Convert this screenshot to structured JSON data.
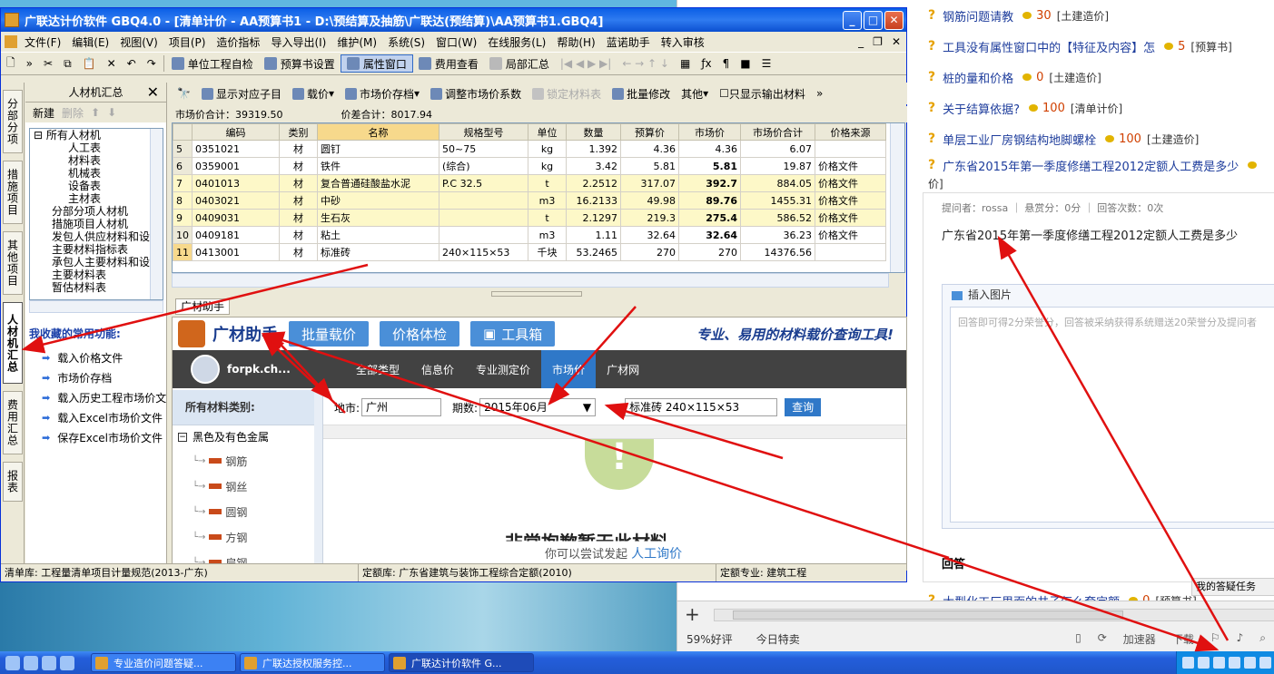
{
  "browser": {
    "questions": [
      {
        "title": "钢筋问题请教",
        "score": "30",
        "cat": "[土建造价]"
      },
      {
        "title": "工具没有属性窗口中的【特征及内容】怎",
        "score": "5",
        "cat": "[预算书]"
      },
      {
        "title": "桩的量和价格",
        "score": "0",
        "cat": "[土建造价]"
      },
      {
        "title": "关于结算依据?",
        "score": "100",
        "cat": "[清单计价]"
      },
      {
        "title": "单层工业厂房钢结构地脚螺栓",
        "score": "100",
        "cat": "[土建造价]"
      },
      {
        "title": "广东省2015年第一季度修缮工程2012定额人工费是多少",
        "score": "",
        "cat": ""
      }
    ],
    "wrap_text": "价]",
    "meta": "提问者：rossa  ｜  悬赏分：0分  ｜  回答次数：0次",
    "question_body": "广东省2015年第一季度修缮工程2012定额人工费是多少",
    "insert_image": "插入图片",
    "answer_placeholder": "回答即可得2分荣誉分，回答被采纳获得系统赠送20荣誉分及提问者",
    "answer_label": "回答",
    "my_task": "我的答疑任务",
    "last_question": {
      "title": "大型化工厂里面的井子怎么套定额",
      "score": "0",
      "cat": "[预算书]"
    },
    "status_items": [
      "59%好评",
      "今日特卖"
    ],
    "status_icons": [
      "加速器",
      "下载"
    ]
  },
  "app": {
    "title": "广联达计价软件 GBQ4.0 - [清单计价 - AA预算书1 - D:\\预结算及抽筋\\广联达(预结算)\\AA预算书1.GBQ4]",
    "menu": [
      "文件(F)",
      "编辑(E)",
      "视图(V)",
      "项目(P)",
      "造价指标",
      "导入导出(I)",
      "维护(M)",
      "系统(S)",
      "窗口(W)",
      "在线服务(L)",
      "帮助(H)",
      "蓝诺助手",
      "转入审核"
    ],
    "toolbar": [
      "单位工程自检",
      "预算书设置",
      "属性窗口",
      "费用查看",
      "局部汇总"
    ],
    "vtabs": [
      "分部分项",
      "措施项目",
      "其他项目",
      "人材机汇总",
      "费用汇总",
      "报表"
    ],
    "left_panel": {
      "title": "人材机汇总",
      "new": "新建",
      "delete": "删除",
      "tree": [
        "所有人材机",
        "人工表",
        "材料表",
        "机械表",
        "设备表",
        "主材表",
        "分部分项人材机",
        "措施项目人材机",
        "发包人供应材料和设",
        "主要材料指标表",
        "承包人主要材料和设",
        "主要材料表",
        "暂估材料表"
      ],
      "fav_title": "我收藏的常用功能:",
      "favorites": [
        "载入价格文件",
        "市场价存档",
        "载入历史工程市场价文",
        "载入Excel市场价文件",
        "保存Excel市场价文件"
      ]
    },
    "data_tools": [
      "显示对应子目",
      "载价",
      "市场价存档",
      "调整市场价系数",
      "锁定材料表",
      "批量修改",
      "其他",
      "只显示输出材料"
    ],
    "sum": {
      "market_total": "市场价合计：39319.50",
      "diff_total": "价差合计：8017.94"
    },
    "columns": [
      "",
      "编码",
      "类别",
      "名称",
      "规格型号",
      "单位",
      "数量",
      "预算价",
      "市场价",
      "市场价合计",
      "价格来源"
    ],
    "rows": [
      {
        "no": "5",
        "code": "0351021",
        "type": "材",
        "name": "圆钉",
        "spec": "50~75",
        "unit": "kg",
        "qty": "1.392",
        "budget": "4.36",
        "market": "4.36",
        "total": "6.07",
        "source": "",
        "yellow": false,
        "boldm": false
      },
      {
        "no": "6",
        "code": "0359001",
        "type": "材",
        "name": "铁件",
        "spec": "(综合)",
        "unit": "kg",
        "qty": "3.42",
        "budget": "5.81",
        "market": "5.81",
        "total": "19.87",
        "source": "价格文件",
        "yellow": false,
        "boldm": true
      },
      {
        "no": "7",
        "code": "0401013",
        "type": "材",
        "name": "复合普通硅酸盐水泥",
        "spec": "P.C 32.5",
        "unit": "t",
        "qty": "2.2512",
        "budget": "317.07",
        "market": "392.7",
        "total": "884.05",
        "source": "价格文件",
        "yellow": true,
        "boldm": true
      },
      {
        "no": "8",
        "code": "0403021",
        "type": "材",
        "name": "中砂",
        "spec": "",
        "unit": "m3",
        "qty": "16.2133",
        "budget": "49.98",
        "market": "89.76",
        "total": "1455.31",
        "source": "价格文件",
        "yellow": true,
        "boldm": true
      },
      {
        "no": "9",
        "code": "0409031",
        "type": "材",
        "name": "生石灰",
        "spec": "",
        "unit": "t",
        "qty": "2.1297",
        "budget": "219.3",
        "market": "275.4",
        "total": "586.52",
        "source": "价格文件",
        "yellow": true,
        "boldm": true
      },
      {
        "no": "10",
        "code": "0409181",
        "type": "材",
        "name": "粘土",
        "spec": "",
        "unit": "m3",
        "qty": "1.11",
        "budget": "32.64",
        "market": "32.64",
        "total": "36.23",
        "source": "价格文件",
        "yellow": false,
        "boldm": true
      },
      {
        "no": "11",
        "code": "0413001",
        "type": "材",
        "name": "标准砖",
        "spec": "240×115×53",
        "unit": "千块",
        "qty": "53.2465",
        "budget": "270",
        "market": "270",
        "total": "14376.56",
        "source": "",
        "yellow": false,
        "boldm": false
      }
    ],
    "subtab": "广材助手",
    "gc": {
      "logo": "广材助手",
      "tabs": [
        "批量载价",
        "价格体检",
        "工具箱"
      ],
      "slogan": "专业、易用的材料载价查询工具!",
      "user": "forpk.ch...",
      "nav": [
        "全部类型",
        "信息价",
        "专业测定价",
        "市场价",
        "广材网"
      ],
      "side_title": "所有材料类别:",
      "cat_root": "黑色及有色金属",
      "subs": [
        "钢筋",
        "钢丝",
        "圆钢",
        "方钢",
        "扁钢"
      ],
      "area_label": "地市:",
      "area": "广州",
      "period_label": "期数:",
      "period": "2015年06月",
      "keyword": "标准砖 240×115×53",
      "search": "查询",
      "empty_big": "非常抱歉暂无此材料",
      "empty_hint": "你可以尝试发起",
      "empty_link": "人工询价"
    },
    "status": [
      "清单库: 工程量清单项目计量规范(2013-广东)",
      "定额库: 广东省建筑与装饰工程综合定额(2010)",
      "定额专业: 建筑工程"
    ]
  },
  "taskbar": {
    "tasks": [
      "专业造价问题答疑...",
      "广联达授权服务控...",
      "广联达计价软件 G..."
    ]
  }
}
